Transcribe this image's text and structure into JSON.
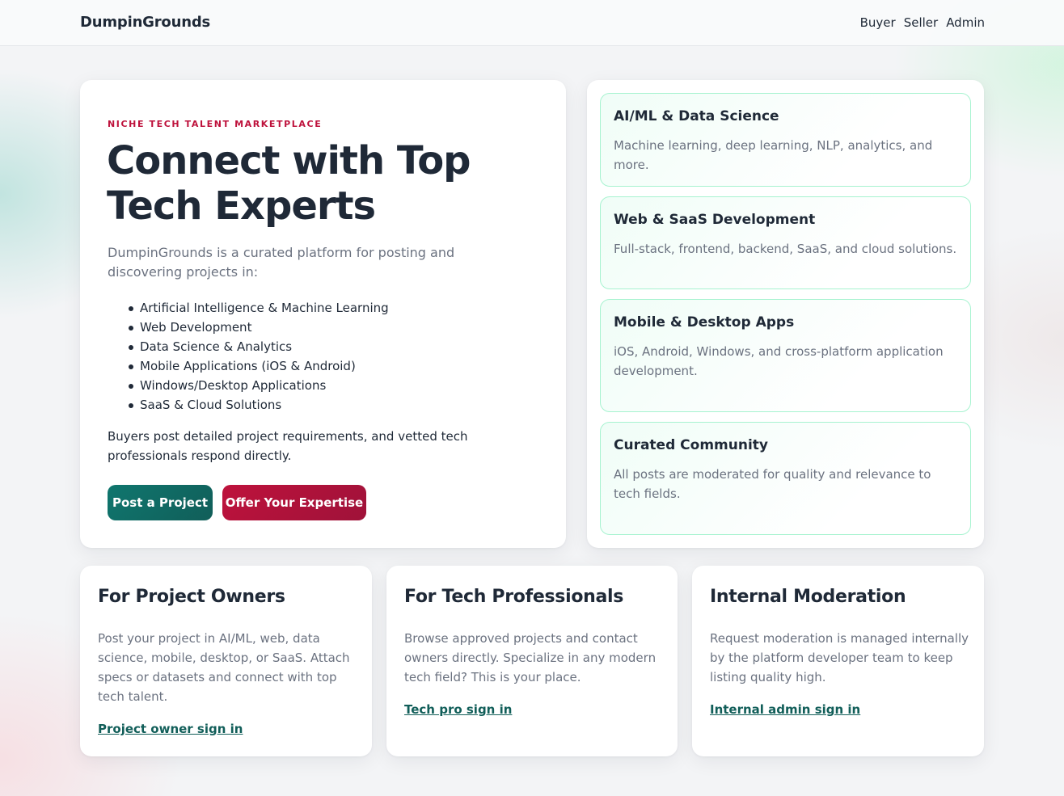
{
  "header": {
    "brand": "DumpinGrounds",
    "nav": [
      "Buyer",
      "Seller",
      "Admin"
    ]
  },
  "hero": {
    "eyebrow": "NICHE TECH TALENT MARKETPLACE",
    "title": "Connect with Top Tech Experts",
    "intro": "DumpinGrounds is a curated platform for posting and discovering projects in:",
    "fields": [
      "Artificial Intelligence & Machine Learning",
      "Web Development",
      "Data Science & Analytics",
      "Mobile Applications (iOS & Android)",
      "Windows/Desktop Applications",
      "SaaS & Cloud Solutions"
    ],
    "description": "Buyers post detailed project requirements, and vetted tech professionals respond directly.",
    "primary_button": "Post a Project",
    "secondary_button": "Offer Your Expertise"
  },
  "features": [
    {
      "title": "AI/ML & Data Science",
      "text": "Machine learning, deep learning, NLP, analytics, and more."
    },
    {
      "title": "Web & SaaS Development",
      "text": "Full-stack, frontend, backend, SaaS, and cloud solutions."
    },
    {
      "title": "Mobile & Desktop Apps",
      "text": "iOS, Android, Windows, and cross-platform application development."
    },
    {
      "title": "Curated Community",
      "text": "All posts are moderated for quality and relevance to tech fields."
    }
  ],
  "audience_cards": [
    {
      "title": "For Project Owners",
      "text": "Post your project in AI/ML, web, data science, mobile, desktop, or SaaS. Attach specs or datasets and connect with top tech talent.",
      "link": "Project owner sign in"
    },
    {
      "title": "For Tech Professionals",
      "text": "Browse approved projects and contact owners directly. Specialize in any modern tech field? This is your place.",
      "link": "Tech pro sign in"
    },
    {
      "title": "Internal Moderation",
      "text": "Request moderation is managed internally by the platform developer team to keep listing quality high.",
      "link": "Internal admin sign in"
    }
  ],
  "colors": {
    "accent_teal": "#0f766e",
    "accent_rose": "#be123c",
    "text_dark": "#1f2937",
    "text_muted": "#6b7280"
  }
}
